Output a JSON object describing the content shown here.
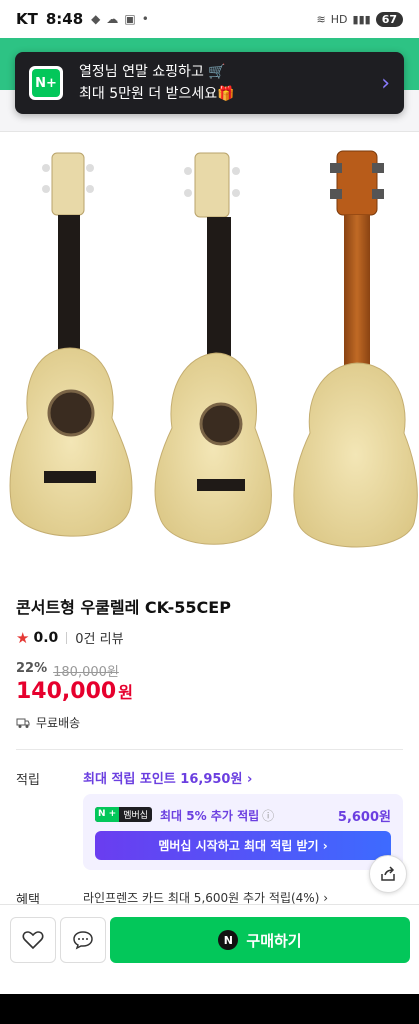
{
  "status": {
    "carrier": "KT",
    "time": "8:48",
    "battery": "67"
  },
  "toast": {
    "line1": "열정님 연말 쇼핑하고 🛒",
    "line2": "최대 5만원 더 받으세요🎁"
  },
  "product": {
    "title": "콘서트형 우쿨렐레 CK-55CEP",
    "rating": "0.0",
    "reviews": "0건 리뷰",
    "discount_pct": "22%",
    "original_price": "180,000원",
    "price": "140,000",
    "price_unit": "원",
    "shipping": "무료배송"
  },
  "points": {
    "label": "적립",
    "link": "최대 적립 포인트 16,950원 ›",
    "badge_n": "N +",
    "badge_m": "멤버십",
    "extra": "최대 5% 추가 적립",
    "extra_amount": "5,600원",
    "membership_button": "멤버십 시작하고 최대 적립 받기 ›"
  },
  "benefit": {
    "label": "혜택",
    "text": "라인프렌즈 카드 최대 5,600원 추가 적립(4%) ›"
  },
  "actions": {
    "buy": "구매하기"
  },
  "colors": {
    "accent": "#03c75a",
    "price": "#e6002d",
    "membership": "#6b3fe0"
  }
}
